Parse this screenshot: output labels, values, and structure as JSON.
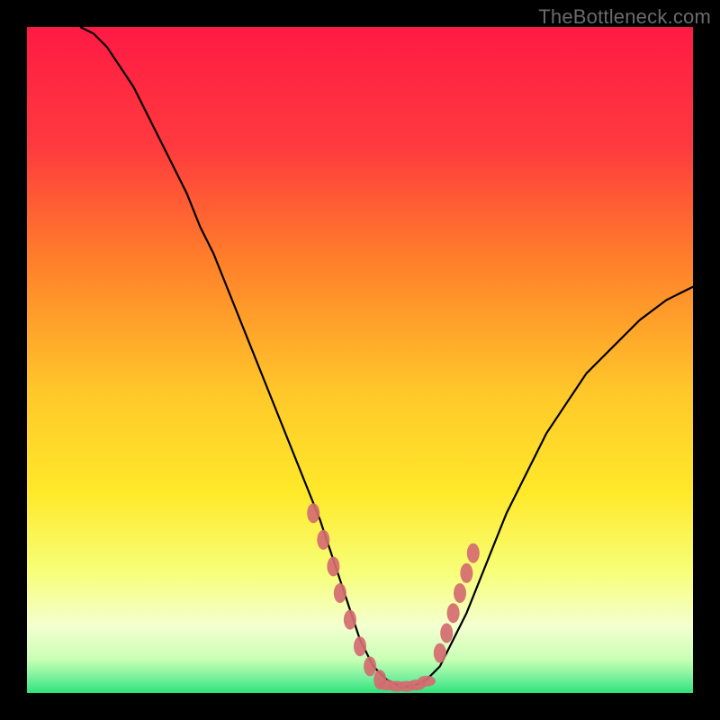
{
  "watermark": "TheBottleneck.com",
  "colors": {
    "top": "#ff1a44",
    "upper_mid": "#ff7f2a",
    "mid": "#ffe92a",
    "lower_mid": "#f7ff7a",
    "pale": "#f4ffd0",
    "green": "#2fe27b",
    "marker": "#d46b70",
    "curve": "#000000",
    "frame": "#000000"
  },
  "chart_data": {
    "type": "line",
    "title": "",
    "xlabel": "",
    "ylabel": "",
    "xlim": [
      0,
      100
    ],
    "ylim": [
      0,
      100
    ],
    "x": [
      8,
      10,
      12,
      14,
      16,
      18,
      20,
      22,
      24,
      26,
      28,
      30,
      32,
      34,
      36,
      38,
      40,
      42,
      44,
      46,
      47,
      48,
      49,
      50,
      51,
      52,
      53,
      54,
      55,
      56,
      57,
      58,
      59,
      60,
      62,
      64,
      66,
      68,
      70,
      72,
      74,
      76,
      78,
      80,
      82,
      84,
      86,
      88,
      90,
      92,
      94,
      96,
      98,
      100
    ],
    "values": [
      100,
      99,
      97,
      94,
      91,
      87,
      83,
      79,
      75,
      70,
      66,
      61,
      56,
      51,
      46,
      41,
      36,
      31,
      26,
      20,
      17,
      14,
      11,
      8,
      6,
      4,
      3,
      2,
      1.5,
      1,
      1,
      1,
      1.5,
      2,
      4,
      8,
      12,
      17,
      22,
      27,
      31,
      35,
      39,
      42,
      45,
      48,
      50,
      52,
      54,
      56,
      57.5,
      59,
      60,
      61
    ],
    "series": [
      {
        "name": "bottleneck-curve",
        "note": "single black V-shaped curve; y is approximate bottleneck percentage"
      }
    ],
    "markers": {
      "note": "salmon bead clusters near trough of curve",
      "left_cluster_x": [
        43,
        44.5,
        46,
        47,
        48.5,
        50,
        51.5,
        53
      ],
      "left_cluster_y": [
        27,
        23,
        19,
        15,
        11,
        7,
        4,
        2
      ],
      "bottom_cluster_x": [
        54,
        55.5,
        57,
        58.5,
        60
      ],
      "bottom_cluster_y": [
        1.2,
        1,
        1,
        1.2,
        1.8
      ],
      "right_cluster_x": [
        62,
        63,
        64,
        65,
        66,
        67
      ],
      "right_cluster_y": [
        6,
        9,
        12,
        15,
        18,
        21
      ]
    }
  }
}
